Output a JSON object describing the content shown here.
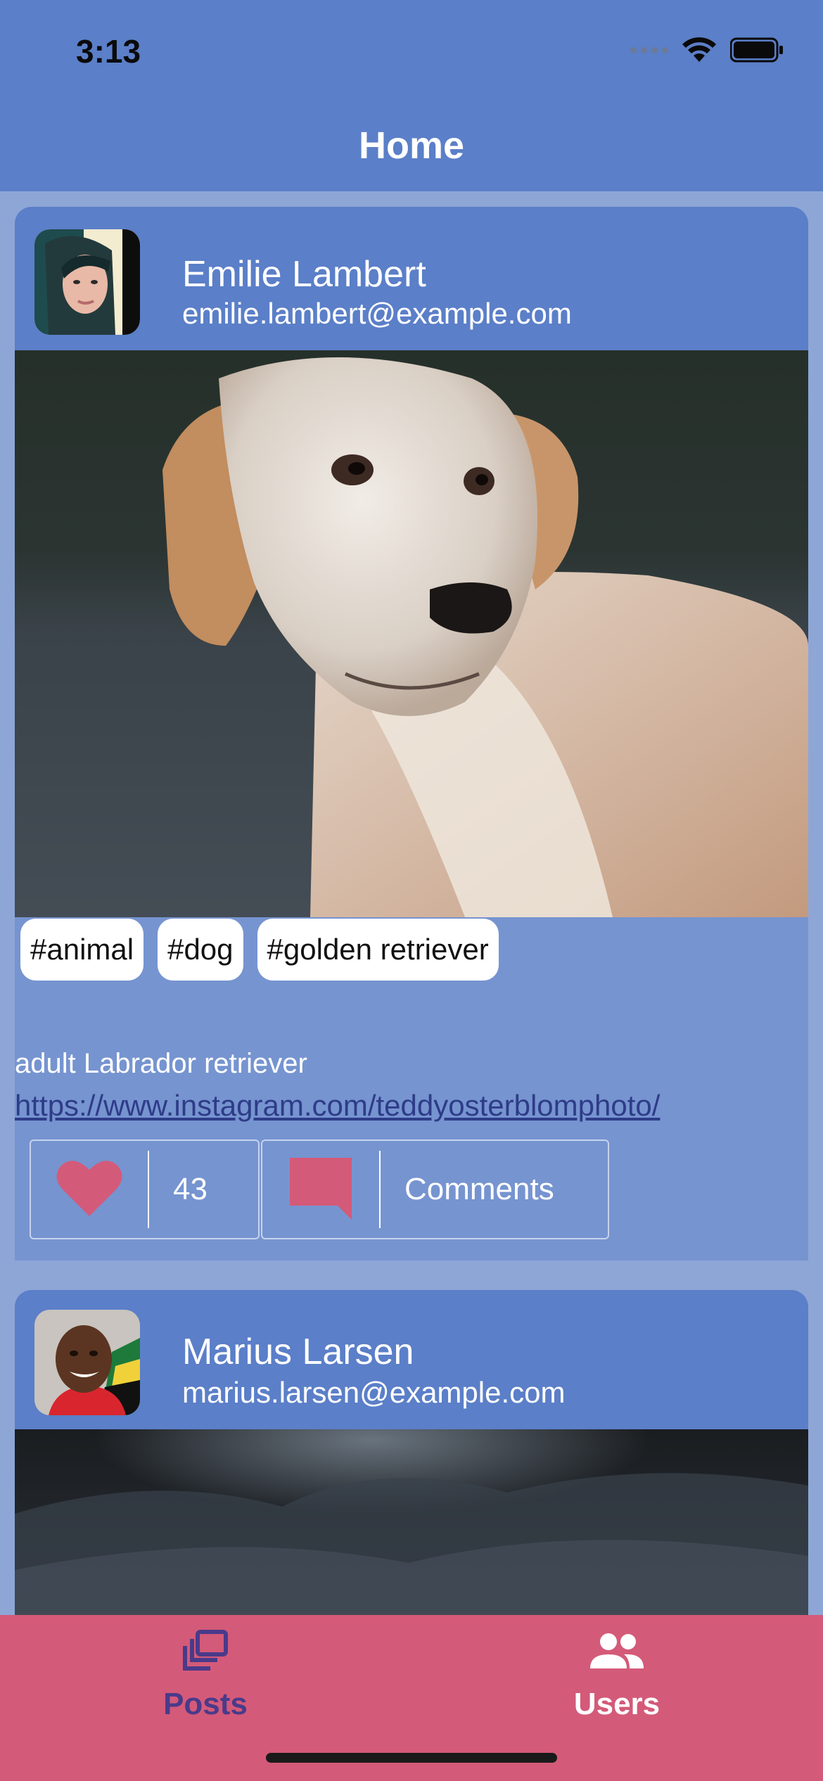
{
  "status_bar": {
    "time": "3:13",
    "icons": [
      "cellular-signal-icon",
      "wifi-icon",
      "battery-icon"
    ]
  },
  "header": {
    "title": "Home"
  },
  "posts": [
    {
      "user": {
        "name": "Emilie Lambert",
        "email": "emilie.lambert@example.com",
        "avatar_icon": "avatar"
      },
      "image_subject": "golden retriever dog",
      "tags": [
        "#animal",
        "#dog",
        "#golden retriever"
      ],
      "caption": "adult Labrador retriever",
      "link": "https://www.instagram.com/teddyosterblomphoto/",
      "likes": "43",
      "comments_label": "Comments"
    },
    {
      "user": {
        "name": "Marius Larsen",
        "email": "marius.larsen@example.com",
        "avatar_icon": "avatar"
      },
      "image_subject": "dark rocky landscape"
    }
  ],
  "tabbar": {
    "tabs": [
      {
        "label": "Posts",
        "icon": "posts-stack-icon",
        "color": "#4a3a8a"
      },
      {
        "label": "Users",
        "icon": "users-group-icon",
        "color": "#ffffff"
      }
    ],
    "background": "#d45a79"
  },
  "colors": {
    "header_blue": "#5b7fc8",
    "card_blue": "#7694d0",
    "page_background": "#8ea6d6",
    "accent_pink": "#d45a79"
  }
}
